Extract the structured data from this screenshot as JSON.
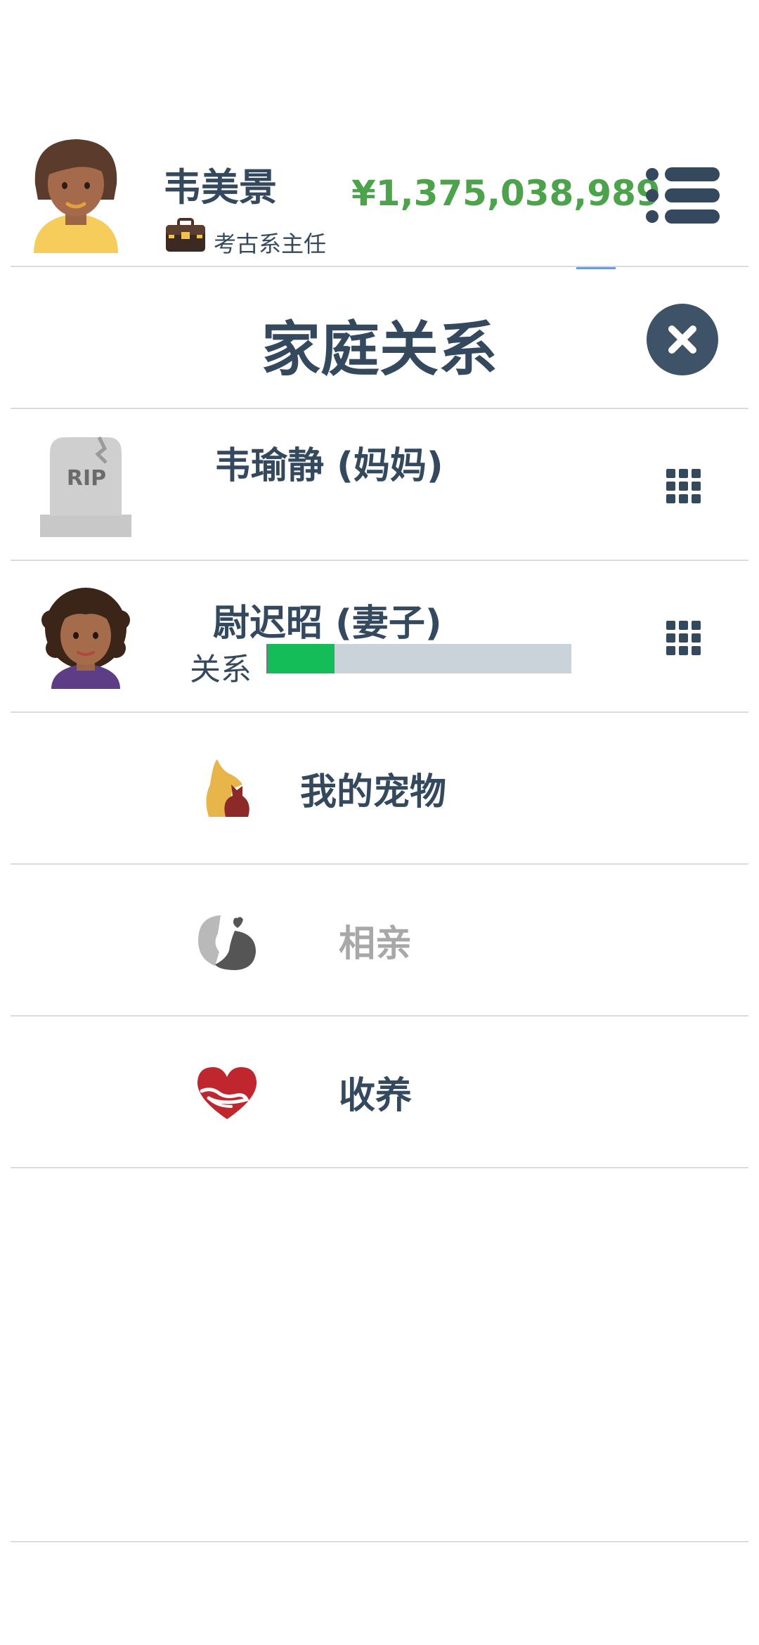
{
  "header": {
    "player_name": "韦美景",
    "job_title": "考古系主任",
    "money": "¥1,375,038,989"
  },
  "modal": {
    "title": "家庭关系"
  },
  "family": [
    {
      "name": "韦瑜静 (妈妈)",
      "status": "deceased",
      "icon": "rip-tombstone-icon"
    },
    {
      "name": "尉迟昭 (妻子)",
      "relationship_label": "关系",
      "relationship_level": 0.22,
      "icon": "wife-avatar"
    }
  ],
  "actions": [
    {
      "label": "我的宠物",
      "icon": "pets-icon",
      "enabled": true
    },
    {
      "label": "相亲",
      "icon": "dating-icon",
      "enabled": false
    },
    {
      "label": "收养",
      "icon": "adoption-heart-icon",
      "enabled": true
    }
  ],
  "colors": {
    "text": "#34495e",
    "money": "#4ca34c",
    "relationship_fill": "#14bd57",
    "relationship_track": "#cbd3da",
    "disabled_text": "#a8a8a8",
    "close_button": "#3e5268"
  }
}
